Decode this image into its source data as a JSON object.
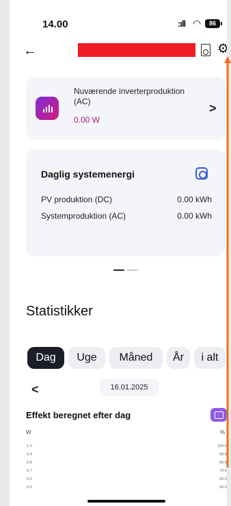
{
  "status_bar": {
    "time": "14.00",
    "signal": ":ıll",
    "wifi": "wifi-icon",
    "battery": "86"
  },
  "header": {
    "back": "←",
    "doc_icon": "document-icon",
    "settings_icon": "gear-icon"
  },
  "production_card": {
    "title": "Nuværende inverterproduktion (AC)",
    "value": "0.00 W",
    "chevron": ">"
  },
  "energy_card": {
    "title": "Daglig systemenergi",
    "rows": [
      {
        "label": "PV produktion (DC)",
        "value": "0.00 kWh"
      },
      {
        "label": "Systemproduktion (AC)",
        "value": "0.00 kWh"
      }
    ]
  },
  "statistics": {
    "title": "Statistikker",
    "tabs": [
      "Dag",
      "Uge",
      "Måned",
      "År",
      "i alt"
    ],
    "active_tab": "Dag",
    "prev": "<",
    "date": "16.01.2025"
  },
  "chart": {
    "title": "Effekt beregnet efter dag",
    "unit_left": "W",
    "unit_right": "%",
    "ticks_left": [
      "1.0",
      "0.9",
      "0.8",
      "0.7",
      "0.6",
      "0.5"
    ],
    "ticks_right": [
      "100.0",
      "90.0",
      "80.0",
      "70.0",
      "60.0",
      "50.0"
    ]
  },
  "colors": {
    "accent_purple": "#8e5ce6",
    "value_magenta": "#b0227f",
    "redaction": "#ee1c24",
    "annotation_arrow": "#e8741f"
  }
}
